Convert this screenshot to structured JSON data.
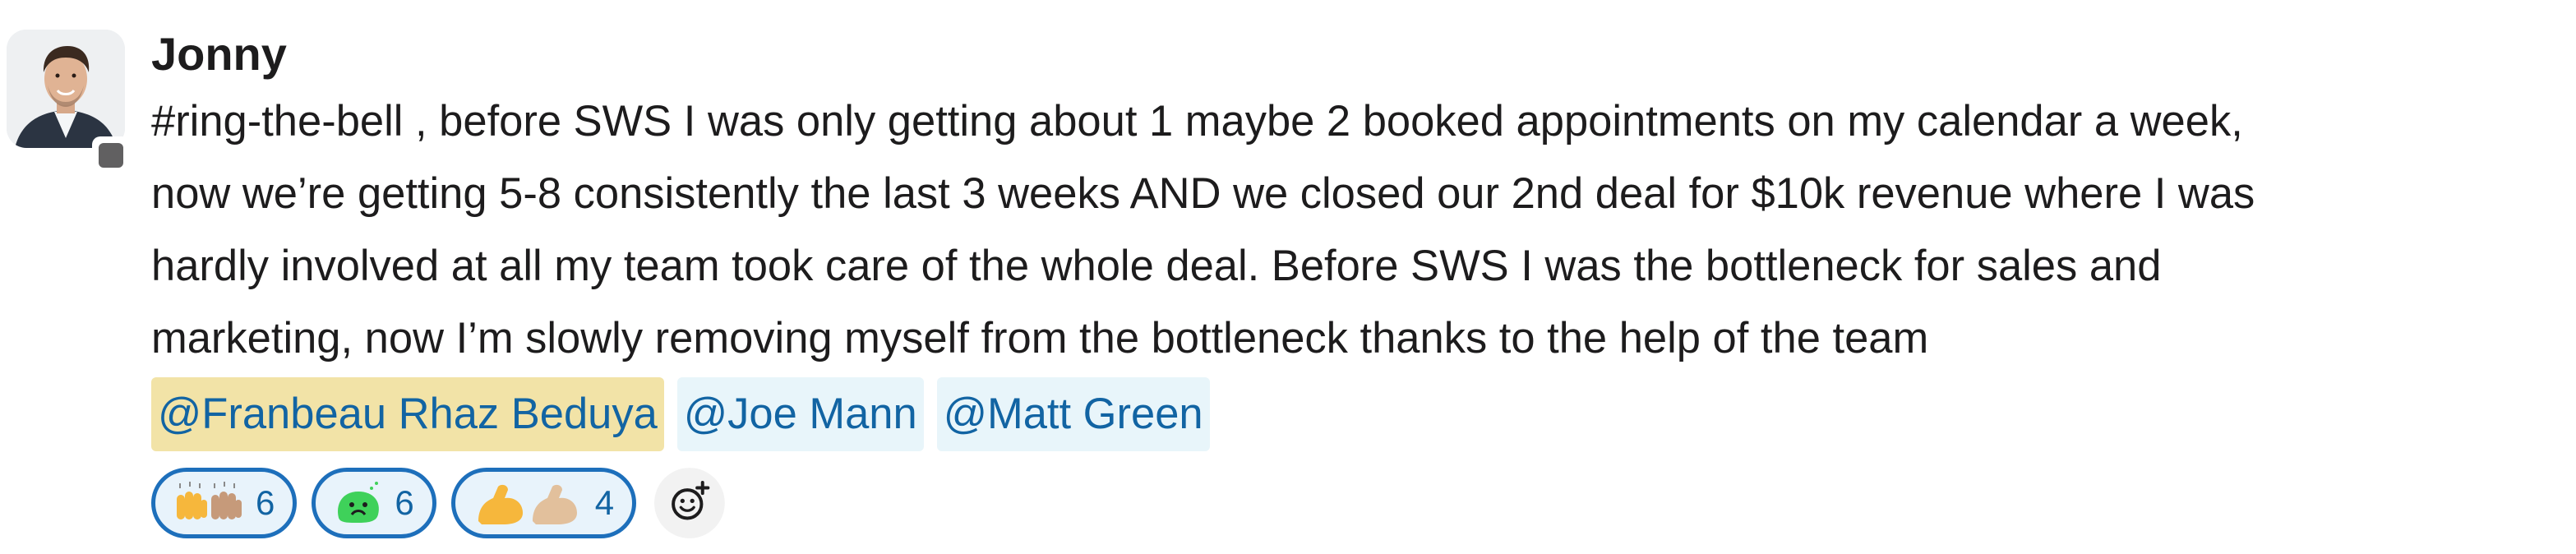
{
  "message": {
    "author": "Jonny",
    "avatar": "user-photo-avatar",
    "presence_status": "away",
    "lines": [
      "#ring-the-bell , before SWS I was only getting about 1 maybe 2 booked appointments on my calendar a week,",
      "now we’re getting 5-8 consistently the last 3 weeks AND we closed our 2nd deal for $10k revenue where I was",
      "hardly involved at all my team took care of the whole deal. Before SWS I was the bottleneck for sales and",
      "marketing, now I’m slowly removing myself from the bottleneck thanks to the help of the team"
    ],
    "mentions": [
      {
        "label": "@Franbeau Rhaz Beduya",
        "highlight": true
      },
      {
        "label": "@Joe Mann",
        "highlight": false
      },
      {
        "label": "@Matt Green",
        "highlight": false
      }
    ],
    "reactions": [
      {
        "emoji": "raised-hands-icon",
        "count": "6"
      },
      {
        "emoji": "sick-face-icon",
        "count": "6"
      },
      {
        "emoji": "flexed-biceps-icon",
        "count": "4"
      }
    ],
    "add_reaction_icon": "add-emoji-icon"
  },
  "colors": {
    "mention_text": "#1264a3",
    "mention_bg": "#e8f5fa",
    "mention_self_bg": "#f2e3a7",
    "reaction_border": "#1d6fbb",
    "reaction_bg": "#e8f3fb"
  }
}
